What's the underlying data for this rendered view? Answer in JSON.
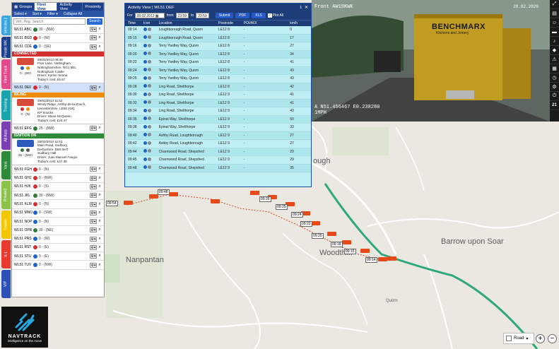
{
  "vertical_tabs": [
    "Vehicles 2",
    "Private WK...",
    "Fleet Track",
    "Tracking",
    "All Auto",
    "Vans",
    "Private2",
    "Tracker",
    "X-1",
    "VIP"
  ],
  "panel_tabs": [
    "Groups",
    "Fleet View",
    "Activity View",
    "Proximity"
  ],
  "toolbar": {
    "select": "Select",
    "sort": "Sort",
    "filter": "Filter",
    "collapse": "Collapse All"
  },
  "search": {
    "placeholder": "Veh. Reg. Search",
    "button": "Search"
  },
  "vehicles_top": [
    {
      "reg": "WL51 ABC",
      "speed": "30 - (NW)",
      "color": "#2e7d32"
    },
    {
      "reg": "WL51 BGD",
      "speed": "0 - (W)",
      "color": "#d32f2f"
    },
    {
      "reg": "WL51 CDE",
      "speed": "0 - (SE)",
      "color": "#1e63c9"
    }
  ],
  "connected": {
    "header": "CONNECTED",
    "date": "28/02/2013 09:48",
    "addr1": "Friar Lane, Nottingham,",
    "addr2": "Nottinghamshire. NG1 6EL",
    "poi": "Nottingham Castle",
    "driver": "Driver: Kyrion Senna",
    "cost": "Today's cost: £6.67",
    "speed": "0 - (SE)"
  },
  "vehicle_def": {
    "reg": "WL51 DEF",
    "speed": "0 - (N)"
  },
  "idling": {
    "header": "IDLING",
    "date": "28/02/2013 11:52",
    "addr1": "Windy Ridge, Ashby-de-la-Zouch,",
    "addr2": "Leicestershire. LE65 2UQ",
    "poi": "KP Snacks",
    "driver": "Driver: Steve McQueen",
    "cost": "Today's cost: £24.47",
    "speed": "0 - (N)"
  },
  "vehicle_efg": {
    "reg": "WL51 EFG",
    "speed": "25 - (NW)"
  },
  "ignition": {
    "header": "IGNITION ON",
    "date": "28/02/2013 11:53",
    "addr1": "Main Road, Sudbury,",
    "addr2": "Derbyshire. DE6 5HT",
    "poi": "Sudbury Hall",
    "driver": "Driver: Juan Manuel Fangio",
    "cost": "Today's cost: £27.35",
    "speed": "25 - (NW)"
  },
  "vehicles_bottom": [
    {
      "reg": "WL51 FGH",
      "speed": "0 - (N)",
      "color": "#d32f2f"
    },
    {
      "reg": "WL51 GHJ",
      "speed": "0 - (NW)",
      "color": "#d32f2f"
    },
    {
      "reg": "WL51 HJK",
      "speed": "0 - (S)",
      "color": "#d32f2f"
    },
    {
      "reg": "WL51 JKL",
      "speed": "30 - (NW)",
      "color": "#2e7d32"
    },
    {
      "reg": "WL51 KLM",
      "speed": "0 - (N)",
      "color": "#d32f2f"
    },
    {
      "reg": "WL51 MNO",
      "speed": "0 - (SW)",
      "color": "#1e63c9"
    },
    {
      "reg": "WL51 NOP",
      "speed": "0 - (N)",
      "color": "#1e63c9"
    },
    {
      "reg": "WL51 OPR",
      "speed": "30 - (NE)",
      "color": "#2e7d32"
    },
    {
      "reg": "WL51 PRS",
      "speed": "0 - (W)",
      "color": "#1e63c9"
    },
    {
      "reg": "WL51 RST",
      "speed": "0 - (E)",
      "color": "#d32f2f"
    },
    {
      "reg": "WL51 STU",
      "speed": "0 - (E)",
      "color": "#1e63c9"
    },
    {
      "reg": "WL51 TUV",
      "speed": "0 - (NW)",
      "color": "#1e63c9"
    }
  ],
  "logo": {
    "name": "NAVTRACK",
    "tagline": "intelligence on the move"
  },
  "activity": {
    "title": "Activity View | WL51 DEF",
    "from_label": "For",
    "date": "28.02.2013",
    "from2": "from",
    "t1": "23:59",
    "to": "to",
    "t2": "23:59",
    "submit": "Submit",
    "pdf": "PDF",
    "xls": "XLS",
    "plot": "Plot All",
    "headers": [
      "Time",
      "Icon",
      "Location",
      "Postcode",
      "POI/AOI",
      "km/h"
    ],
    "rows": [
      {
        "t": "09:14",
        "loc": "Loughborough Road, Quorn",
        "pc": "LE12 8",
        "poi": "-",
        "kmh": "0"
      },
      {
        "t": "09:15",
        "loc": "Loughborough Road, Quorn",
        "pc": "LE12 8",
        "poi": "-",
        "kmh": "17"
      },
      {
        "t": "09:16",
        "loc": "Terry Yardley Way, Quorn",
        "pc": "LE12 8",
        "poi": "-",
        "kmh": "27"
      },
      {
        "t": "09:20",
        "loc": "Terry Yardley Way, Quorn",
        "pc": "LE12 8",
        "poi": "-",
        "kmh": "34"
      },
      {
        "t": "09:22",
        "loc": "Terry Yardley Way, Quorn",
        "pc": "LE12 8",
        "poi": "-",
        "kmh": "41"
      },
      {
        "t": "09:24",
        "loc": "Terry Yardley Way, Quorn",
        "pc": "LE12 8",
        "poi": "-",
        "kmh": "43"
      },
      {
        "t": "09:25",
        "loc": "Terry Yardley Way, Quorn",
        "pc": "LE12 8",
        "poi": "-",
        "kmh": "43"
      },
      {
        "t": "09:28",
        "loc": "Ling Road, Shelthorpe",
        "pc": "LE12 8",
        "poi": "-",
        "kmh": "42"
      },
      {
        "t": "09:30",
        "loc": "Ling Road, Shelthorpe",
        "pc": "LE12 9",
        "poi": "-",
        "kmh": "41"
      },
      {
        "t": "09:32",
        "loc": "Ling Road, Shelthorpe",
        "pc": "LE12 9",
        "poi": "-",
        "kmh": "41"
      },
      {
        "t": "09:34",
        "loc": "Ling Road, Shelthorpe",
        "pc": "LE12 9",
        "poi": "-",
        "kmh": "43"
      },
      {
        "t": "09:35",
        "loc": "Epinal Way, Shelthorpe",
        "pc": "LE12 9",
        "poi": "-",
        "kmh": "50"
      },
      {
        "t": "09:38",
        "loc": "Epinal Way, Shelthorpe",
        "pc": "LE12 9",
        "poi": "-",
        "kmh": "33"
      },
      {
        "t": "09:40",
        "loc": "Ashby Road, Loughborough",
        "pc": "LE12 9",
        "poi": "-",
        "kmh": "27"
      },
      {
        "t": "09:42",
        "loc": "Ashby Road, Loughborough",
        "pc": "LE12 9",
        "poi": "-",
        "kmh": "27"
      },
      {
        "t": "09:44",
        "loc": "Charnwood Road, Shepshed",
        "pc": "LE12 9",
        "poi": "-",
        "kmh": "23"
      },
      {
        "t": "09:45",
        "loc": "Charnwood Road, Shepshed",
        "pc": "LE12 9",
        "poi": "-",
        "kmh": "29"
      },
      {
        "t": "09:48",
        "loc": "Charnwood Road, Shepshed",
        "pc": "LE12 9",
        "poi": "-",
        "kmh": "35"
      }
    ]
  },
  "camera": {
    "plate": "Front AW19KWK",
    "timestamp": "28.02.2020",
    "coords": "A N51.456467 E0.238280",
    "speed": "1MPH",
    "van_brand": "BENCHMARX",
    "van_sub": "Kitchens and Joinery"
  },
  "map": {
    "places": [
      "Nanpantan",
      "Barrow upon Soar",
      "Quorn",
      "ough",
      "Woodth..."
    ],
    "route_times": [
      "09:48",
      "09:54",
      "09:26",
      "09:25",
      "09:24",
      "09:22",
      "09:20",
      "09:18",
      "09:15",
      "09:14"
    ],
    "type": "Road"
  },
  "right_icons": [
    "expand-icon",
    "map-icon",
    "person-icon",
    "car-icon",
    "bell-icon",
    "tag-icon",
    "warning-icon",
    "grid-icon",
    "clock-icon",
    "gear-icon",
    "power-icon",
    "count"
  ],
  "right_count": "21"
}
